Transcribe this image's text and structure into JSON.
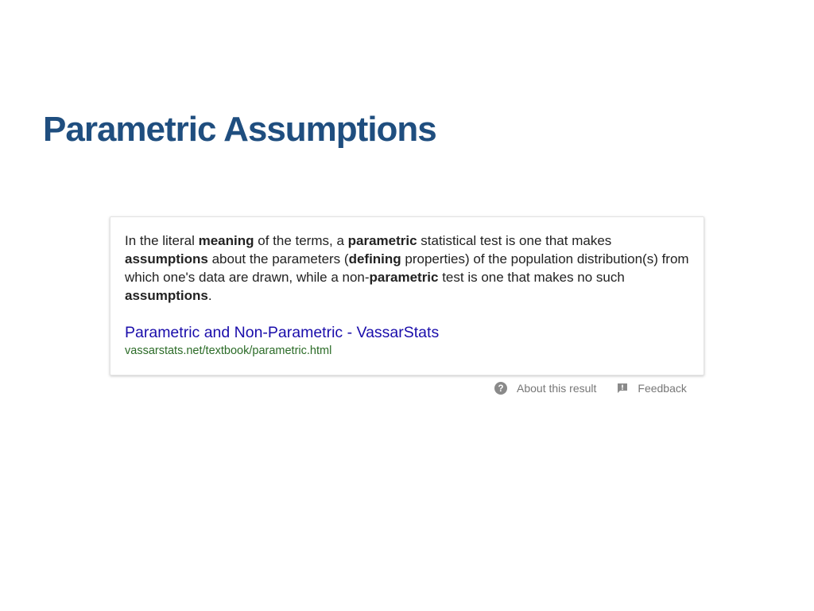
{
  "slide": {
    "title": "Parametric Assumptions"
  },
  "result": {
    "snippet": [
      {
        "text": "In the literal ",
        "bold": false
      },
      {
        "text": "meaning",
        "bold": true
      },
      {
        "text": " of the terms, a ",
        "bold": false
      },
      {
        "text": "parametric",
        "bold": true
      },
      {
        "text": " statistical test is one that makes ",
        "bold": false
      },
      {
        "text": "assumptions",
        "bold": true
      },
      {
        "text": " about the parameters (",
        "bold": false
      },
      {
        "text": "defining",
        "bold": true
      },
      {
        "text": " properties) of the population distribution(s) from which one's data are drawn, while a non-",
        "bold": false
      },
      {
        "text": "parametric",
        "bold": true
      },
      {
        "text": " test is one that makes no such ",
        "bold": false
      },
      {
        "text": "assumptions",
        "bold": true
      },
      {
        "text": ".",
        "bold": false
      }
    ],
    "link_title": "Parametric and Non-Parametric - VassarStats",
    "url": "vassarstats.net/textbook/parametric.html"
  },
  "footer": {
    "about_label": "About this result",
    "feedback_label": "Feedback",
    "about_icon": "question-circle-icon",
    "feedback_icon": "feedback-flag-icon"
  },
  "colors": {
    "title": "#1f4e7f",
    "link": "#1a0dab",
    "url": "#2b6b27",
    "footer_text": "#777777"
  }
}
